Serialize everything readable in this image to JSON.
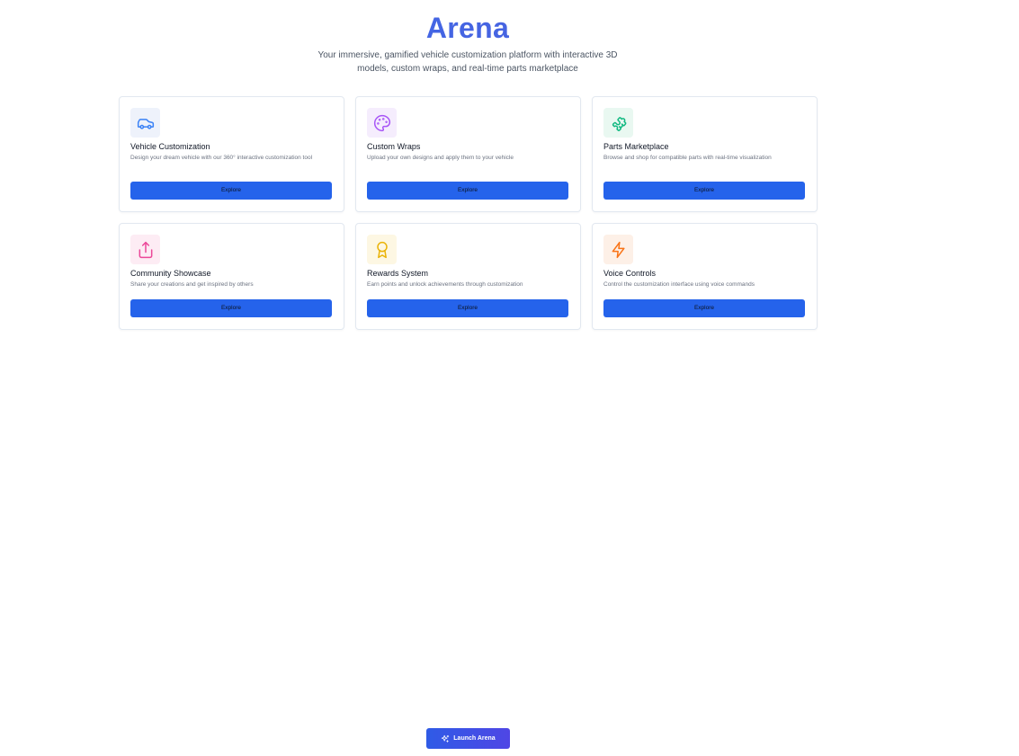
{
  "header": {
    "title": "Arena",
    "subtitle": "Your immersive, gamified vehicle customization platform with interactive 3D models, custom wraps, and real-time parts marketplace"
  },
  "cards": [
    {
      "title": "Vehicle Customization",
      "description": "Design your dream vehicle with our 360° interactive customization tool",
      "button_label": "Explore",
      "icon": "car-icon",
      "icon_color": "#3b82f6",
      "icon_bg": "#eef2fb"
    },
    {
      "title": "Custom Wraps",
      "description": "Upload your own designs and apply them to your vehicle",
      "button_label": "Explore",
      "icon": "palette-icon",
      "icon_color": "#a855f7",
      "icon_bg": "#f5edfd"
    },
    {
      "title": "Parts Marketplace",
      "description": "Browse and shop for compatible parts with real-time visualization",
      "button_label": "Explore",
      "icon": "puzzle-icon",
      "icon_color": "#10b981",
      "icon_bg": "#e9f8f1"
    },
    {
      "title": "Community Showcase",
      "description": "Share your creations and get inspired by others",
      "button_label": "Explore",
      "icon": "share-icon",
      "icon_color": "#ec4899",
      "icon_bg": "#fdecf4"
    },
    {
      "title": "Rewards System",
      "description": "Earn points and unlock achievements through customization",
      "button_label": "Explore",
      "icon": "award-icon",
      "icon_color": "#eab308",
      "icon_bg": "#fdf7e3"
    },
    {
      "title": "Voice Controls",
      "description": "Control the customization interface using voice commands",
      "button_label": "Explore",
      "icon": "zap-icon",
      "icon_color": "#f97316",
      "icon_bg": "#fdf0e7"
    }
  ],
  "launch": {
    "label": "Launch Arena",
    "icon": "sparkles-icon"
  },
  "colors": {
    "accent": "#2563eb",
    "title": "#4169e1",
    "launch_gradient_start": "#2f5be6",
    "launch_gradient_end": "#4f46e5"
  }
}
